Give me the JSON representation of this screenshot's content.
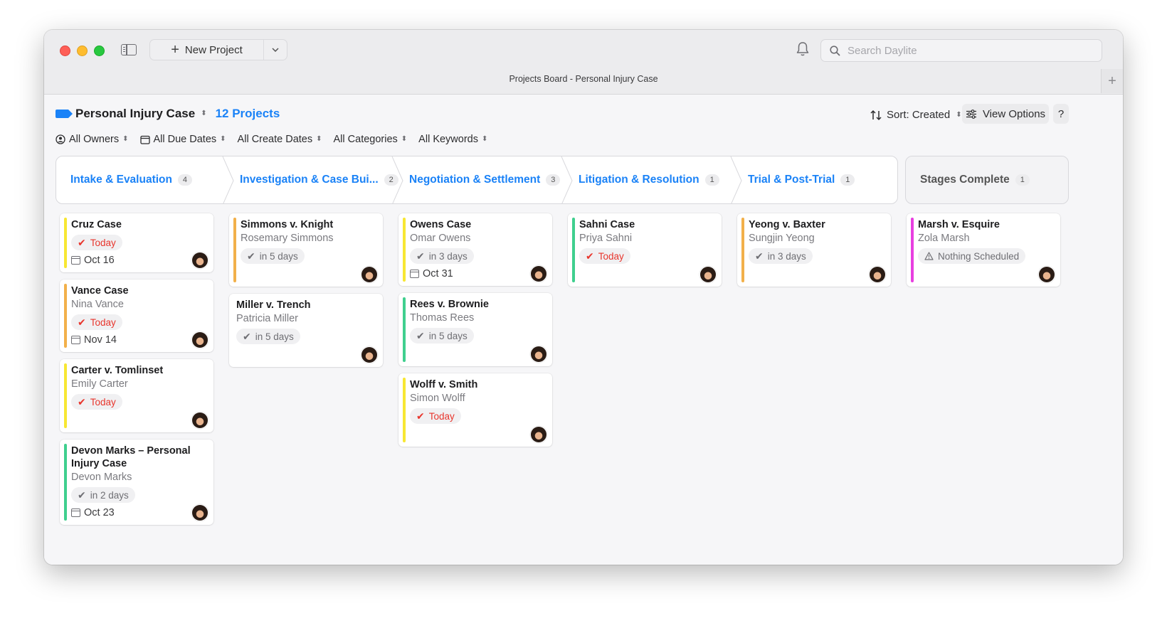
{
  "titlebar": {
    "new_project_label": "New Project",
    "search_placeholder": "Search Daylite",
    "window_title": "Projects Board - Personal Injury Case"
  },
  "header": {
    "pipeline_name": "Personal Injury Case",
    "project_count": "12 Projects",
    "sort_label": "Sort: Created",
    "view_options_label": "View Options",
    "help_label": "?"
  },
  "filters": [
    {
      "label": "All Owners",
      "icon": "person-circle-icon"
    },
    {
      "label": "All Due Dates",
      "icon": "calendar-icon"
    },
    {
      "label": "All Create Dates",
      "icon": ""
    },
    {
      "label": "All Categories",
      "icon": ""
    },
    {
      "label": "All Keywords",
      "icon": ""
    }
  ],
  "stages": [
    {
      "label": "Intake & Evaluation",
      "count": "4"
    },
    {
      "label": "Investigation & Case Bui...",
      "count": "2"
    },
    {
      "label": "Negotiation & Settlement",
      "count": "3"
    },
    {
      "label": "Litigation & Resolution",
      "count": "1"
    },
    {
      "label": "Trial & Post-Trial",
      "count": "1"
    },
    {
      "label": "Stages Complete",
      "count": "1"
    }
  ],
  "columns": [
    {
      "cards": [
        {
          "title": "Cruz Case",
          "subtitle": "",
          "status": "Today",
          "status_type": "today",
          "date": "Oct 16",
          "color": "#f7e733"
        },
        {
          "title": "Vance Case",
          "subtitle": "Nina Vance",
          "status": "Today",
          "status_type": "today",
          "date": "Nov 14",
          "color": "#f2b04a"
        },
        {
          "title": "Carter v. Tomlinset",
          "subtitle": "Emily Carter",
          "status": "Today",
          "status_type": "today",
          "date": "",
          "color": "#f7e733"
        },
        {
          "title": "Devon Marks – Personal Injury Case",
          "subtitle": "Devon Marks",
          "status": "in 2 days",
          "status_type": "due",
          "date": "Oct 23",
          "color": "#3fcf8e"
        }
      ]
    },
    {
      "cards": [
        {
          "title": "Simmons v. Knight",
          "subtitle": "Rosemary Simmons",
          "status": "in 5 days",
          "status_type": "due",
          "date": "",
          "color": "#f2b04a"
        },
        {
          "title": "Miller v. Trench",
          "subtitle": "Patricia Miller",
          "status": "in 5 days",
          "status_type": "due",
          "date": "",
          "color": ""
        }
      ]
    },
    {
      "cards": [
        {
          "title": "Owens Case",
          "subtitle": "Omar Owens",
          "status": "in 3 days",
          "status_type": "due",
          "date": "Oct 31",
          "color": "#f7e733"
        },
        {
          "title": "Rees v. Brownie",
          "subtitle": "Thomas Rees",
          "status": "in 5 days",
          "status_type": "due",
          "date": "",
          "color": "#3fcf8e"
        },
        {
          "title": "Wolff v. Smith",
          "subtitle": "Simon Wolff",
          "status": "Today",
          "status_type": "today",
          "date": "",
          "color": "#f7e733"
        }
      ]
    },
    {
      "cards": [
        {
          "title": "Sahni Case",
          "subtitle": "Priya Sahni",
          "status": "Today",
          "status_type": "today",
          "date": "",
          "color": "#3fcf8e"
        }
      ]
    },
    {
      "cards": [
        {
          "title": "Yeong v. Baxter",
          "subtitle": "Sungjin Yeong",
          "status": "in 3 days",
          "status_type": "due",
          "date": "",
          "color": "#f2b04a"
        }
      ]
    },
    {
      "cards": [
        {
          "title": "Marsh v. Esquire",
          "subtitle": "Zola Marsh",
          "status": "Nothing Scheduled",
          "status_type": "none",
          "date": "",
          "color": "#e83fe0"
        }
      ]
    }
  ]
}
